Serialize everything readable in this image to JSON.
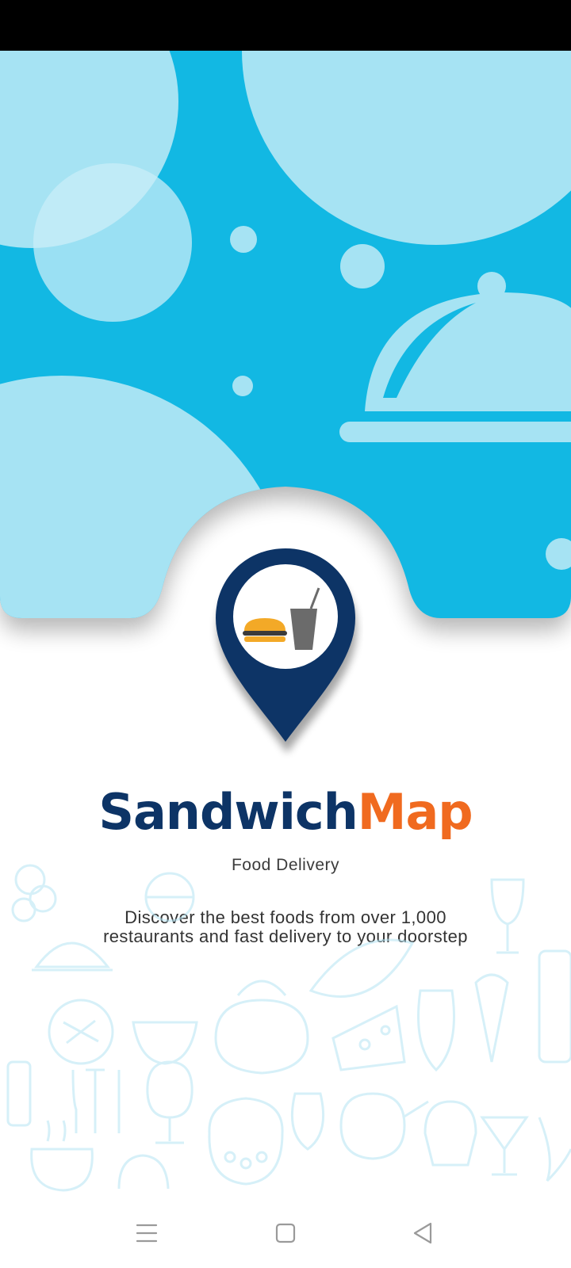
{
  "app": {
    "brand_part1": "Sandwich",
    "brand_part2": "Map",
    "subtitle": "Food Delivery",
    "tagline": "Discover the best foods from over 1,000 restaurants and fast delivery to your doorstep"
  },
  "icons": {
    "hero": "food-cloche-icon",
    "logo": "map-pin-food-icon",
    "nav_menu": "menu-icon",
    "nav_home": "home-square-icon",
    "nav_back": "back-triangle-icon"
  },
  "colors": {
    "hero_blue": "#12b8e3",
    "bubble": "#a6e3f3",
    "brand_navy": "#0d3466",
    "brand_orange": "#f06a1f"
  }
}
